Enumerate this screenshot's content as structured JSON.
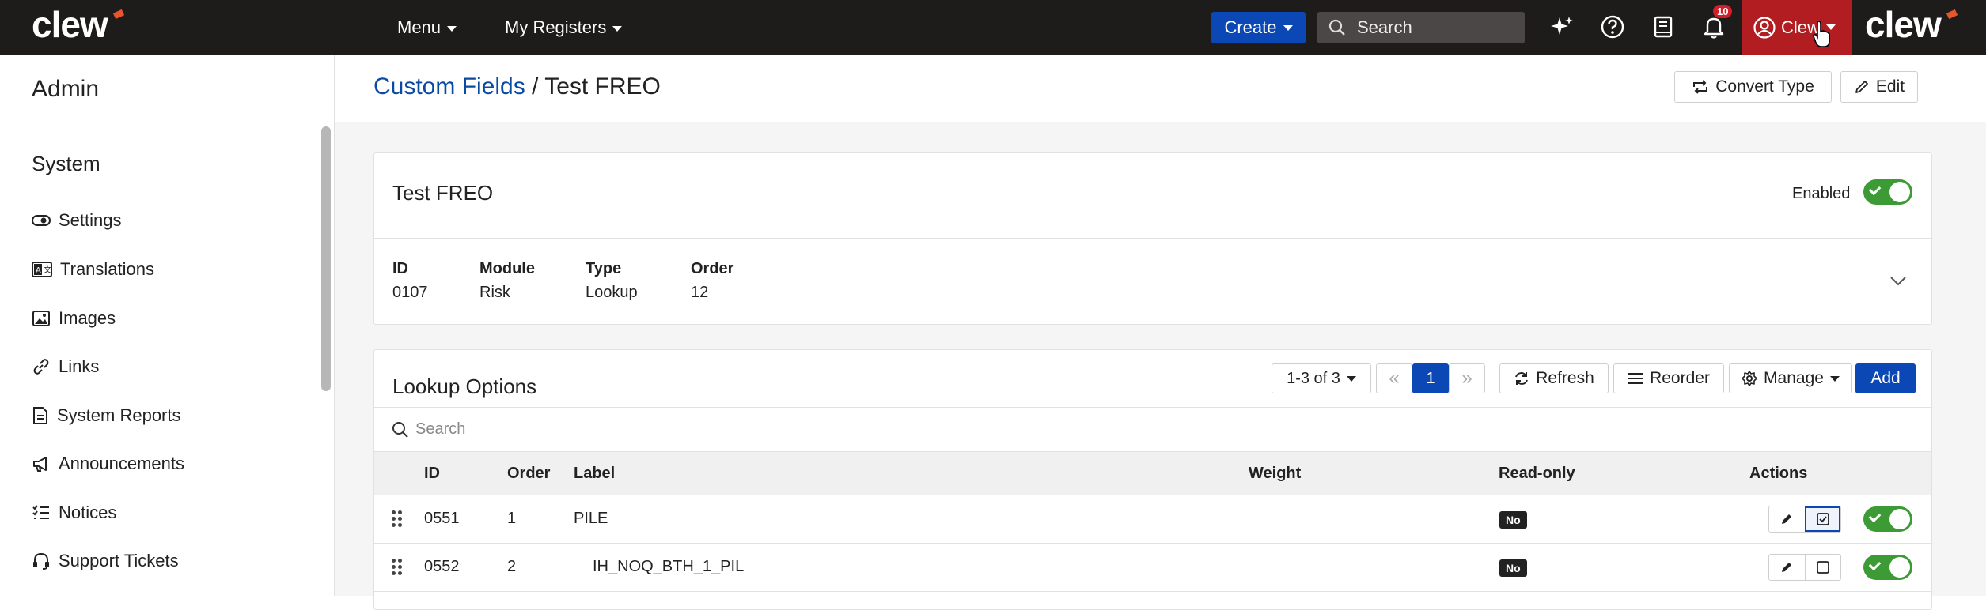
{
  "topbar": {
    "logo_left": "clew",
    "logo_right": "clew",
    "menu_label": "Menu",
    "registers_label": "My Registers",
    "create_label": "Create",
    "search_placeholder": "Search",
    "notifications_count": "10",
    "user_label": "Clew",
    "colors": {
      "bar": "#1e1b1b",
      "create": "#0b48b5",
      "user": "#b21d21"
    }
  },
  "sidebar": {
    "title": "Admin",
    "section": "System",
    "items": [
      {
        "label": "Settings",
        "icon": "toggle-icon"
      },
      {
        "label": "Translations",
        "icon": "translate-icon"
      },
      {
        "label": "Images",
        "icon": "image-icon"
      },
      {
        "label": "Links",
        "icon": "link-icon"
      },
      {
        "label": "System Reports",
        "icon": "report-icon"
      },
      {
        "label": "Announcements",
        "icon": "megaphone-icon"
      },
      {
        "label": "Notices",
        "icon": "list-icon"
      },
      {
        "label": "Support Tickets",
        "icon": "headset-icon"
      }
    ]
  },
  "header": {
    "breadcrumb_link": "Custom Fields",
    "breadcrumb_sep": "/",
    "breadcrumb_current": "Test FREO",
    "convert_label": "Convert Type",
    "edit_label": "Edit"
  },
  "field_card": {
    "title": "Test FREO",
    "enabled_label": "Enabled",
    "meta": [
      {
        "label": "ID",
        "value": "0107"
      },
      {
        "label": "Module",
        "value": "Risk"
      },
      {
        "label": "Type",
        "value": "Lookup"
      },
      {
        "label": "Order",
        "value": "12"
      }
    ]
  },
  "lookup": {
    "title": "Lookup Options",
    "range_label": "1-3 of 3",
    "first_label": "«",
    "current_page": "1",
    "last_label": "»",
    "refresh_label": "Refresh",
    "reorder_label": "Reorder",
    "manage_label": "Manage",
    "add_label": "Add",
    "search_placeholder": "Search",
    "columns": [
      "ID",
      "Order",
      "Label",
      "Weight",
      "Read-only",
      "Actions"
    ],
    "rows": [
      {
        "id": "0551",
        "order": "1",
        "label": "PILE",
        "weight": "",
        "readonly": "No"
      },
      {
        "id": "0552",
        "order": "2",
        "label": "IH_NOQ_BTH_1_PIL",
        "weight": "",
        "readonly": "No"
      }
    ]
  }
}
